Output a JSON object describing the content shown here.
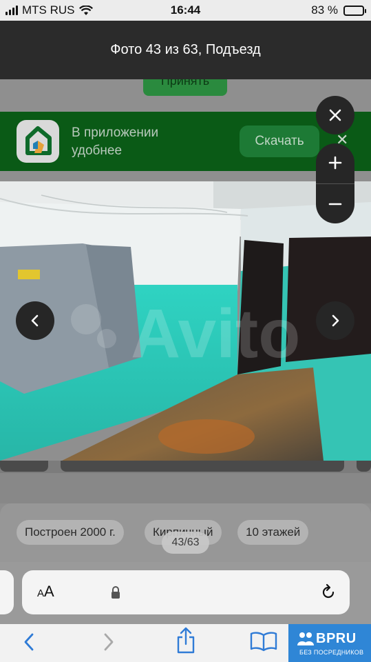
{
  "status_bar": {
    "carrier": "MTS RUS",
    "time": "16:44",
    "battery_percent": "83 %",
    "battery_level": 0.83
  },
  "header": {
    "title": "Фото 43 из 63, Подъезд"
  },
  "page": {
    "accept_label": "Принять",
    "app_banner": {
      "text_line1": "В приложении",
      "text_line2": "удобнее",
      "download_label": "Скачать"
    },
    "chips": [
      "Построен 2000 г.",
      "Кирпичный",
      "10 этажей"
    ]
  },
  "viewer": {
    "counter": "43/63",
    "watermark": "Avito"
  },
  "browser": {
    "text_size_small": "A",
    "text_size_large": "A"
  },
  "badge": {
    "brand": "BPRU",
    "tagline": "БЕЗ ПОСРЕДНИКОВ"
  },
  "icons": {
    "close": "close-icon",
    "zoom_in": "plus-icon",
    "zoom_out": "minus-icon",
    "prev": "chevron-left-icon",
    "next": "chevron-right-icon",
    "lock": "lock-icon",
    "reload": "reload-icon",
    "share": "share-icon",
    "bookmarks": "book-icon"
  },
  "colors": {
    "header_bg": "#2b2b2b",
    "banner_bg": "#0a5a16",
    "brand_badge": "#2f86d6",
    "ios_blue": "#2f7bd6"
  }
}
